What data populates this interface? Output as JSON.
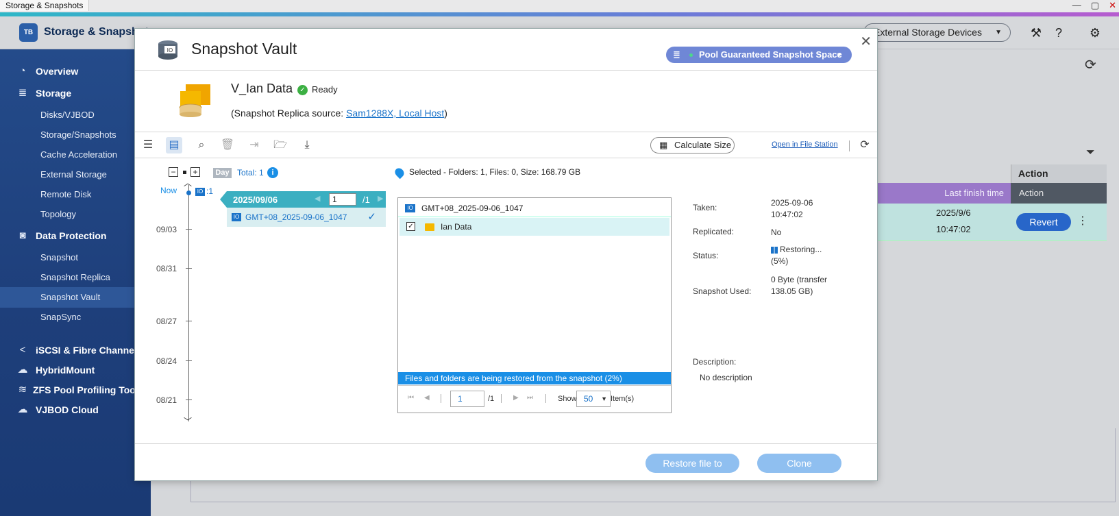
{
  "window": {
    "title": "Storage & Snapshots",
    "controls": [
      "—",
      "▢",
      "✕"
    ]
  },
  "app": {
    "name": "Storage & Snapshots",
    "logo_text": "TB",
    "external_select": "External Storage Devices"
  },
  "sidebar": {
    "items": [
      {
        "label": "Overview",
        "type": "main",
        "icon": "gauge-icon"
      },
      {
        "label": "Storage",
        "type": "main",
        "icon": "database-icon"
      },
      {
        "label": "Disks/VJBOD",
        "type": "sub"
      },
      {
        "label": "Storage/Snapshots",
        "type": "sub"
      },
      {
        "label": "Cache Acceleration",
        "type": "sub"
      },
      {
        "label": "External Storage",
        "type": "sub"
      },
      {
        "label": "Remote Disk",
        "type": "sub"
      },
      {
        "label": "Topology",
        "type": "sub"
      },
      {
        "label": "Data Protection",
        "type": "main",
        "icon": "camera-icon"
      },
      {
        "label": "Snapshot",
        "type": "sub"
      },
      {
        "label": "Snapshot Replica",
        "type": "sub"
      },
      {
        "label": "Snapshot Vault",
        "type": "sub",
        "active": true
      },
      {
        "label": "SnapSync",
        "type": "sub"
      },
      {
        "label": "iSCSI & Fibre Channel",
        "type": "main",
        "icon": "share-icon"
      },
      {
        "label": "HybridMount",
        "type": "main",
        "icon": "cloud-icon"
      },
      {
        "label": "ZFS Pool Profiling Tool",
        "type": "main",
        "icon": "layers-icon"
      },
      {
        "label": "VJBOD Cloud",
        "type": "main",
        "icon": "cloud-icon"
      }
    ]
  },
  "background_table": {
    "action_header": "Action",
    "band_last_finish": "Last finish time",
    "band_action": "Action",
    "row_date": "2025/9/6",
    "row_time": "10:47:02",
    "revert_label": "Revert"
  },
  "modal": {
    "title": "Snapshot Vault",
    "pool_button": "Pool Guaranteed Snapshot Space",
    "volume_name": "V_Ian Data",
    "status": "Ready",
    "source_prefix": "(Snapshot Replica source: ",
    "source_link": "Sam1288X, Local Host",
    "source_suffix": ")",
    "toolbar": {
      "calculate_size": "Calculate Size",
      "open_file_station": "Open in File Station"
    },
    "timeline": {
      "day_badge": "Day",
      "total": "Total: 1",
      "now_label": "Now",
      "now_count": ":1",
      "dates": [
        "09/03",
        "08/31",
        "08/27",
        "08/24",
        "08/21"
      ]
    },
    "snapshot_card": {
      "date": "2025/09/06",
      "page": "1",
      "page_total": "/1",
      "snapshot_name": "GMT+08_2025-09-06_1047"
    },
    "selected_info": "Selected - Folders: 1, Files: 0, Size: 168.79 GB",
    "file_panel": {
      "header": "GMT+08_2025-09-06_1047",
      "folder_name": "Ian Data",
      "banner": "Files and folders are being restored from the snapshot (2%)",
      "page": "1",
      "page_total": "/1",
      "show_label": "Show",
      "show_value": "50",
      "items_label": "Item(s)"
    },
    "details": {
      "taken_label": "Taken:",
      "taken_value": "2025-09-06 10:47:02",
      "replicated_label": "Replicated:",
      "replicated_value": "No",
      "status_label": "Status:",
      "status_value": "Restoring... (5%)",
      "used_label": "Snapshot Used:",
      "used_value": "0 Byte (transfer 138.05 GB)",
      "description_label": "Description:",
      "description_value": "No description"
    },
    "footer": {
      "restore_label": "Restore file to",
      "clone_label": "Clone"
    }
  },
  "colors": {
    "sidebar": "#1e3f7b",
    "accent_teal": "#3bafc1",
    "link_blue": "#1a73c9",
    "pool_button": "#6f87d6",
    "disabled_button": "#8fbff0",
    "progress_banner": "#1a8fe6"
  }
}
